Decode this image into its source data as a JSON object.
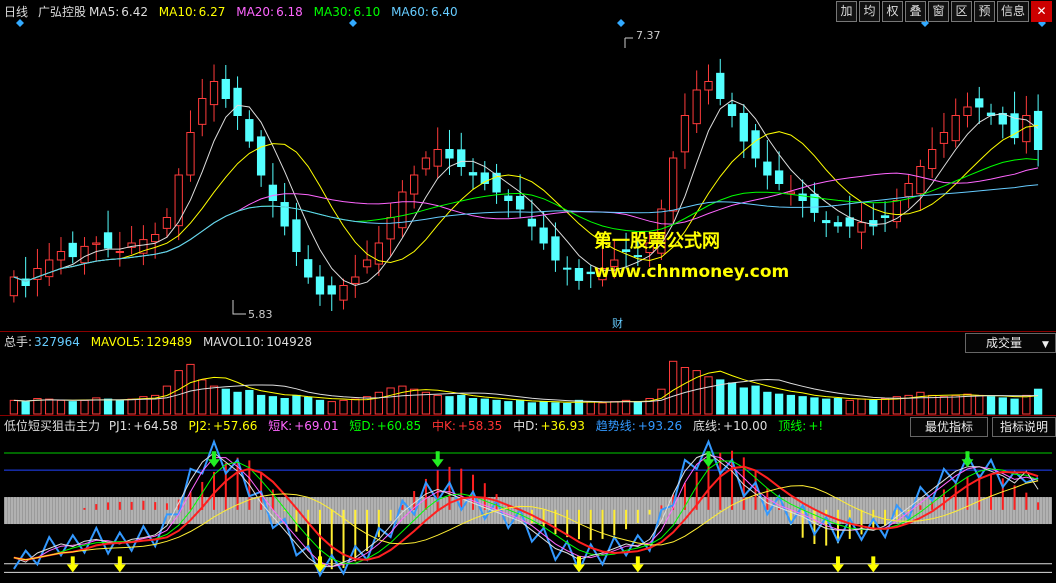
{
  "header": {
    "period": "日线",
    "stock_name": "广弘控股",
    "ma": [
      {
        "name": "MA5:",
        "value": "6.42",
        "color": "#dddddd"
      },
      {
        "name": "MA10:",
        "value": "6.27",
        "color": "#ffff00"
      },
      {
        "name": "MA20:",
        "value": "6.18",
        "color": "#ff66ff"
      },
      {
        "name": "MA30:",
        "value": "6.10",
        "color": "#00ff00"
      },
      {
        "name": "MA60:",
        "value": "6.40",
        "color": "#66ccff"
      }
    ],
    "toolbar": [
      "加",
      "均",
      "权",
      "叠",
      "窗",
      "区",
      "预",
      "信息",
      "✕"
    ]
  },
  "price_pane": {
    "high_label": "7.37",
    "low_label": "5.83",
    "fin_marker": "财",
    "watermark_title": "第一股票公式网",
    "watermark_url": "www.chnmoney.com"
  },
  "volume_pane": {
    "legend": [
      {
        "name": "总手:",
        "value": "327964",
        "color": "#66ccff"
      },
      {
        "name": "MAVOL5:",
        "value": "129489",
        "color": "#ffff00"
      },
      {
        "name": "MAVOL10:",
        "value": "104928",
        "color": "#dddddd"
      }
    ],
    "selector": "成交量"
  },
  "indicator_pane": {
    "title": "低位短买狙击主力",
    "legend": [
      {
        "name": "PJ1:",
        "value": "+64.58",
        "color": "#dddddd"
      },
      {
        "name": "PJ2:",
        "value": "+57.66",
        "color": "#ffff00"
      },
      {
        "name": "短K:",
        "value": "+69.01",
        "color": "#ff66ff"
      },
      {
        "name": "短D:",
        "value": "+60.85",
        "color": "#00ff00"
      },
      {
        "name": "中K:",
        "value": "+58.35",
        "color": "#ff3333"
      },
      {
        "name": "中D:",
        "value": "+36.93",
        "color": "#dddddd"
      },
      {
        "name": "趋势线:",
        "value": "+93.26",
        "color": "#3399ff"
      },
      {
        "name": "底线:",
        "value": "+10.00",
        "color": "#dddddd"
      },
      {
        "name": "顶线:",
        "value": "+!",
        "color": "#00ff00"
      }
    ],
    "buttons": [
      "最优指标",
      "指标说明"
    ]
  },
  "chart_data": [
    {
      "type": "candlestick",
      "title": "广弘控股 日线",
      "y_labels_shown": {
        "high": 7.37,
        "low": 5.83
      },
      "ylim": [
        5.7,
        7.5
      ],
      "close": [
        6.0,
        5.95,
        6.05,
        6.1,
        6.15,
        6.12,
        6.18,
        6.2,
        6.17,
        6.15,
        6.2,
        6.22,
        6.25,
        6.35,
        6.6,
        6.85,
        7.05,
        7.15,
        7.05,
        6.95,
        6.8,
        6.6,
        6.45,
        6.3,
        6.15,
        6.0,
        5.9,
        5.9,
        5.95,
        6.0,
        6.1,
        6.2,
        6.35,
        6.5,
        6.6,
        6.7,
        6.75,
        6.7,
        6.65,
        6.6,
        6.55,
        6.5,
        6.45,
        6.4,
        6.3,
        6.2,
        6.1,
        6.05,
        5.98,
        6.02,
        6.05,
        6.1,
        6.15,
        6.12,
        6.2,
        6.4,
        6.7,
        6.95,
        7.1,
        7.15,
        7.05,
        6.95,
        6.8,
        6.7,
        6.6,
        6.55,
        6.5,
        6.45,
        6.38,
        6.32,
        6.3,
        6.3,
        6.32,
        6.3,
        6.35,
        6.45,
        6.55,
        6.65,
        6.75,
        6.85,
        6.95,
        7.0,
        7.0,
        6.95,
        6.9,
        6.82,
        6.95,
        6.75
      ],
      "ma": {
        "MA5": 6.42,
        "MA10": 6.27,
        "MA20": 6.18,
        "MA30": 6.1,
        "MA60": 6.4
      }
    },
    {
      "type": "bar",
      "title": "成交量",
      "series": [
        {
          "name": "总手",
          "last": 327964
        },
        {
          "name": "MAVOL5",
          "last": 129489
        },
        {
          "name": "MAVOL10",
          "last": 104928
        }
      ],
      "values": [
        0.22,
        0.2,
        0.25,
        0.24,
        0.22,
        0.2,
        0.22,
        0.26,
        0.24,
        0.22,
        0.24,
        0.28,
        0.3,
        0.45,
        0.7,
        0.8,
        0.55,
        0.45,
        0.4,
        0.35,
        0.38,
        0.3,
        0.28,
        0.25,
        0.3,
        0.27,
        0.22,
        0.2,
        0.22,
        0.24,
        0.28,
        0.35,
        0.42,
        0.45,
        0.4,
        0.35,
        0.3,
        0.28,
        0.3,
        0.25,
        0.24,
        0.22,
        0.2,
        0.22,
        0.18,
        0.2,
        0.18,
        0.17,
        0.22,
        0.2,
        0.18,
        0.2,
        0.22,
        0.2,
        0.25,
        0.4,
        0.85,
        0.75,
        0.7,
        0.6,
        0.55,
        0.5,
        0.42,
        0.45,
        0.35,
        0.32,
        0.3,
        0.28,
        0.26,
        0.24,
        0.25,
        0.22,
        0.24,
        0.22,
        0.25,
        0.28,
        0.3,
        0.35,
        0.3,
        0.28,
        0.3,
        0.32,
        0.3,
        0.28,
        0.26,
        0.24,
        0.3,
        0.4
      ]
    },
    {
      "type": "line",
      "title": "低位短买狙击主力",
      "ylim": [
        0,
        100
      ],
      "series": [
        {
          "name": "PJ1",
          "last": 64.58
        },
        {
          "name": "PJ2",
          "last": 57.66
        },
        {
          "name": "短K",
          "last": 69.01
        },
        {
          "name": "短D",
          "last": 60.85
        },
        {
          "name": "中K",
          "last": 58.35
        },
        {
          "name": "中D",
          "last": 36.93
        },
        {
          "name": "趋势线",
          "last": 93.26
        },
        {
          "name": "底线",
          "last": 10.0
        }
      ]
    }
  ]
}
